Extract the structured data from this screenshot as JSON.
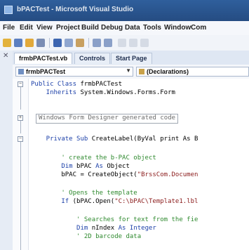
{
  "window": {
    "title": "bPACTest - Microsoft Visual Studio"
  },
  "menu": {
    "items": [
      "File",
      "Edit",
      "View",
      "Project",
      "Build",
      "Debug",
      "Data",
      "Tools",
      "Window",
      "Com"
    ]
  },
  "toolbar": {
    "icons": [
      "new-project-icon",
      "open-icon",
      "save-icon",
      "save-all-icon",
      "cut-icon",
      "copy-icon",
      "paste-icon",
      "undo-icon",
      "redo-icon"
    ]
  },
  "tabs": [
    {
      "label": "frmbPACTest.vb",
      "active": true
    },
    {
      "label": "Controls",
      "active": false
    },
    {
      "label": "Start Page",
      "active": false
    }
  ],
  "navbar": {
    "class_combo": "frmbPACTest",
    "member_combo": "(Declarations)"
  },
  "code": {
    "line1_kw": "Public Class",
    "line1_name": " frmbPACTest",
    "line2_kw": "    Inherits",
    "line2_rest": " System.Windows.Forms.Form",
    "region": "Windows Form Designer generated code",
    "sub_kw": "    Private Sub",
    "sub_rest": " CreateLabel(ByVal print As B",
    "c1": "        ' create the b-PAC object",
    "dim1_kw": "        Dim",
    "dim1_mid": " bPAC ",
    "dim1_kw2": "As",
    "dim1_rest": " Object",
    "set1": "        bPAC = CreateObject(",
    "set1_str": "\"BrssCom.Documen",
    "c2": "        ' Opens the template",
    "if_kw": "        If",
    "if_mid": " (bPAC.Open(",
    "if_str": "\"C:\\bPAC\\Template1.lbl",
    "c3": "            ' Searches for text from the fie",
    "dim2_kw": "            Dim",
    "dim2_mid": " nIndex ",
    "dim2_kw2": "As Integer",
    "c4": "            ' 2D barcode data"
  }
}
